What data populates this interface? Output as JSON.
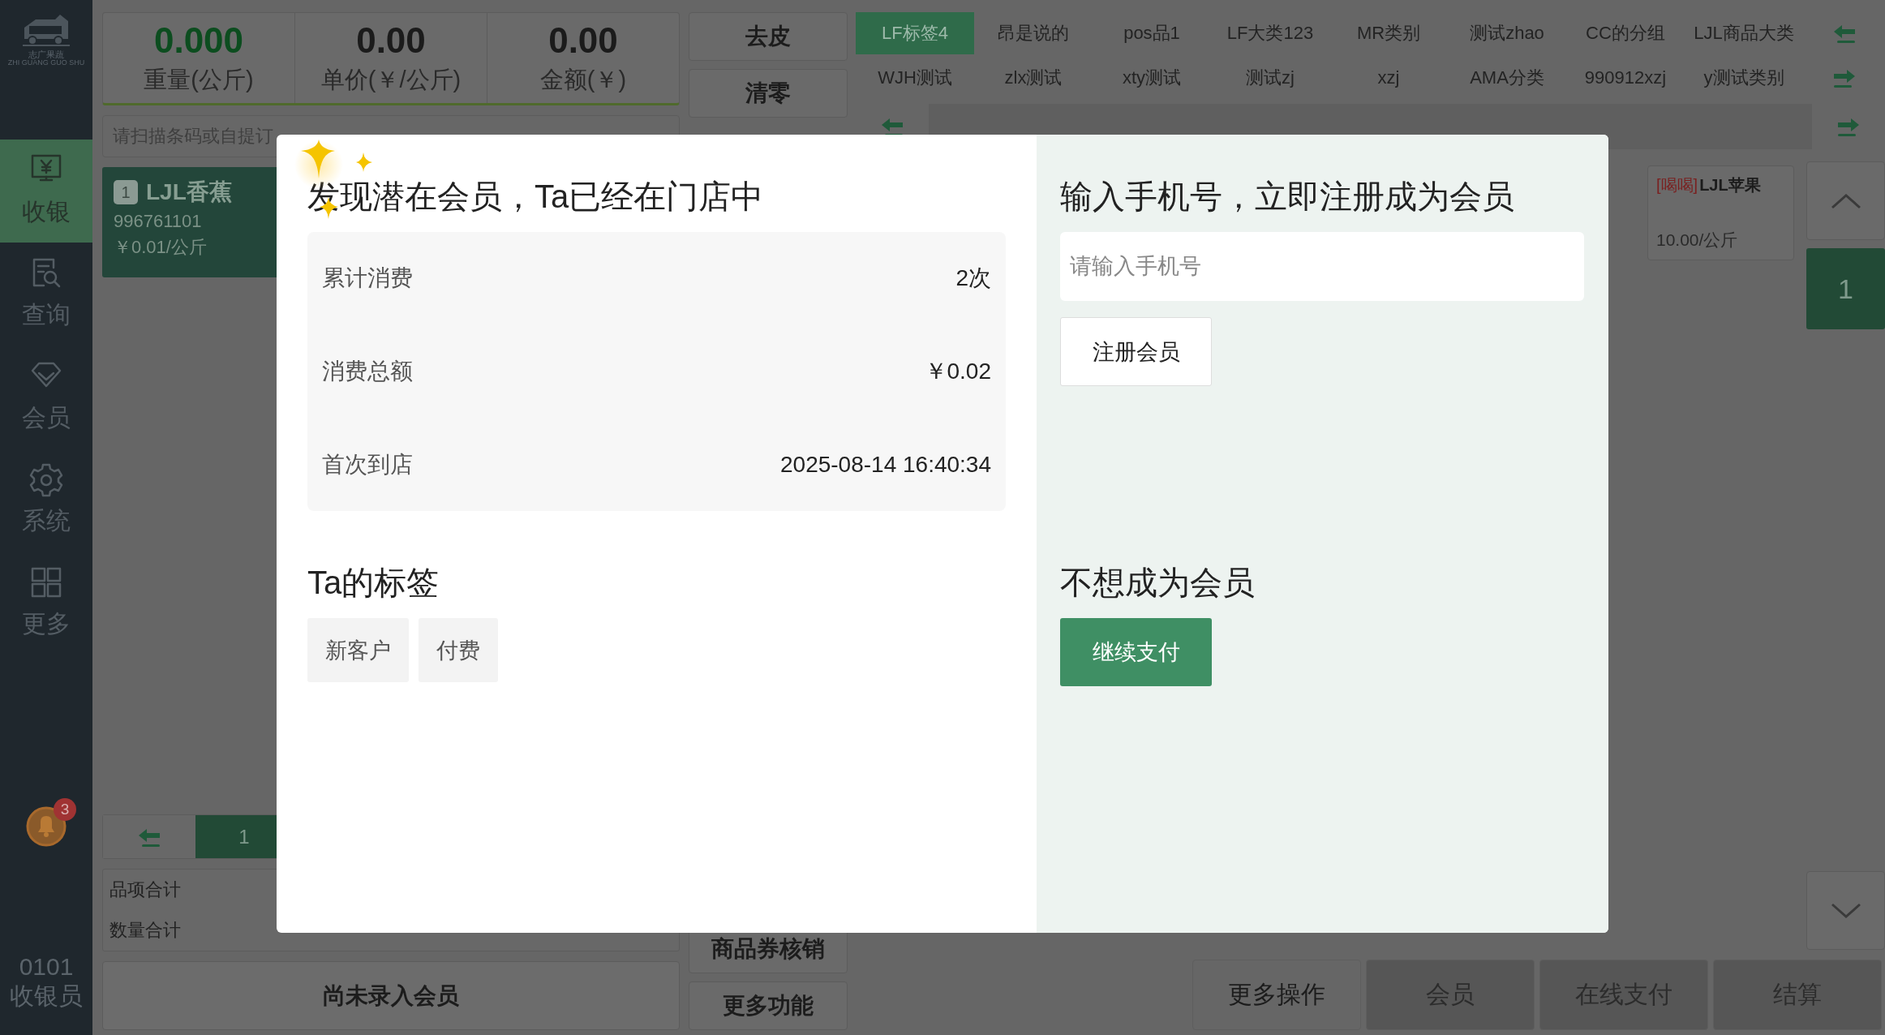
{
  "sidebar": {
    "logo_text": "志广果蔬",
    "logo_subtext": "ZHI GUANG GUO SHU",
    "items": [
      {
        "label": "收银",
        "selected": true
      },
      {
        "label": "查询",
        "selected": false
      },
      {
        "label": "会员",
        "selected": false
      },
      {
        "label": "系统",
        "selected": false
      },
      {
        "label": "更多",
        "selected": false
      }
    ],
    "notification_count": "3",
    "user_id": "0101",
    "user_role": "收银员"
  },
  "scale": [
    {
      "kind": "weight",
      "value": "0.000",
      "label": "重量(公斤)"
    },
    {
      "kind": "price",
      "value": "0.00",
      "label": "单价(￥/公斤)"
    },
    {
      "kind": "price",
      "value": "0.00",
      "label": "金额(￥)"
    }
  ],
  "scan_field": {
    "placeholder": "请扫描条码或自提订"
  },
  "cart_items": [
    {
      "index": "1",
      "name": "LJL香蕉",
      "code": "996761101",
      "price": "￥0.01/公斤"
    }
  ],
  "cart_page": "1",
  "summary_labels": [
    "品项合计",
    "数量合计"
  ],
  "member_button": "尚未录入会员",
  "top_actions": [
    "去皮",
    "清零"
  ],
  "bottom_actions": [
    "商品券核销",
    "更多功能"
  ],
  "categories": [
    {
      "label": "LF标签4",
      "selected": true
    },
    {
      "label": "昂是说的",
      "selected": false
    },
    {
      "label": "pos品1",
      "selected": false
    },
    {
      "label": "LF大类123",
      "selected": false
    },
    {
      "label": "MR类别",
      "selected": false
    },
    {
      "label": "测试zhao",
      "selected": false
    },
    {
      "label": "CC的分组",
      "selected": false
    },
    {
      "label": "LJL商品大类",
      "selected": false
    },
    {
      "label": "WJH测试",
      "selected": false
    },
    {
      "label": "zlx测试",
      "selected": false
    },
    {
      "label": "xty测试",
      "selected": false
    },
    {
      "label": "测试zj",
      "selected": false
    },
    {
      "label": "xzj",
      "selected": false
    },
    {
      "label": "AMA分类",
      "selected": false
    },
    {
      "label": "990912xzj",
      "selected": false
    },
    {
      "label": "y测试类别",
      "selected": false
    }
  ],
  "products": [
    {
      "tag": "[喝喝]",
      "name": "LJL苹果",
      "price": "10.00/公斤"
    }
  ],
  "product_page": "1",
  "footer_buttons": [
    {
      "label": "更多操作",
      "disabled": false
    },
    {
      "label": "会员",
      "disabled": true
    },
    {
      "label": "在线支付",
      "disabled": true
    },
    {
      "label": "结算",
      "disabled": true
    }
  ],
  "modal": {
    "title": "发现潜在会员，Ta已经在门店中",
    "stats": [
      {
        "label": "累计消费",
        "value": "2次"
      },
      {
        "label": "消费总额",
        "value": "￥0.02"
      },
      {
        "label": "首次到店",
        "value": "2025-08-14 16:40:34"
      }
    ],
    "tags_title": "Ta的标签",
    "tags": [
      "新客户",
      "付费"
    ],
    "register_title": "输入手机号，立即注册成为会员",
    "phone_field": {
      "placeholder": "请输入手机号"
    },
    "register_button": "注册会员",
    "decline_title": "不想成为会员",
    "continue_button": "继续支付"
  }
}
